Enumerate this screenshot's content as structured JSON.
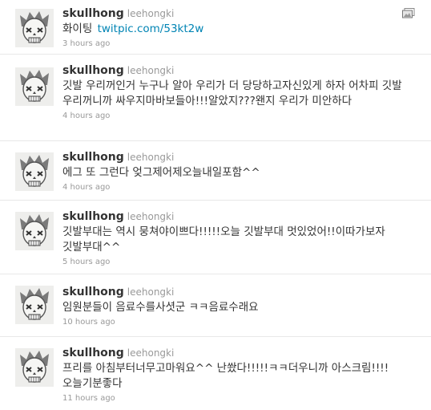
{
  "tweets": [
    {
      "screen_name": "skullhong",
      "full_name": "leehongki",
      "text": "화이팅",
      "link": "twitpic.com/53kt2w",
      "time": "3 hours ago",
      "media_icon": "gallery-icon"
    },
    {
      "screen_name": "skullhong",
      "full_name": "leehongki",
      "text": "깃발 우리꺼인거 누구나 알아 우리가 더 당당하고자신있게 하자 어차피 깃발 우리꺼니까 싸우지마바보들아!!!알았지???왠지 우리가 미안하다",
      "time": "4 hours ago"
    },
    {
      "screen_name": "skullhong",
      "full_name": "leehongki",
      "text": "에그 또 그런다 엊그제어제오늘내일포함^^",
      "time": "4 hours ago"
    },
    {
      "screen_name": "skullhong",
      "full_name": "leehongki",
      "text": "깃발부대는 역시 뭉쳐야이쁘다!!!!!오늘 깃발부대 멋있었어!!이따가보자 깃발부대^^",
      "time": "5 hours ago"
    },
    {
      "screen_name": "skullhong",
      "full_name": "leehongki",
      "text": "임원분들이 음료수를사셧군 ㅋㅋ음료수래요",
      "time": "10 hours ago"
    },
    {
      "screen_name": "skullhong",
      "full_name": "leehongki",
      "text": "프리를 아침부터너무고마워요^^ 난쐈다!!!!!ㅋㅋ더우니까 아스크림!!!!오늘기분좋다",
      "time": "11 hours ago"
    }
  ]
}
